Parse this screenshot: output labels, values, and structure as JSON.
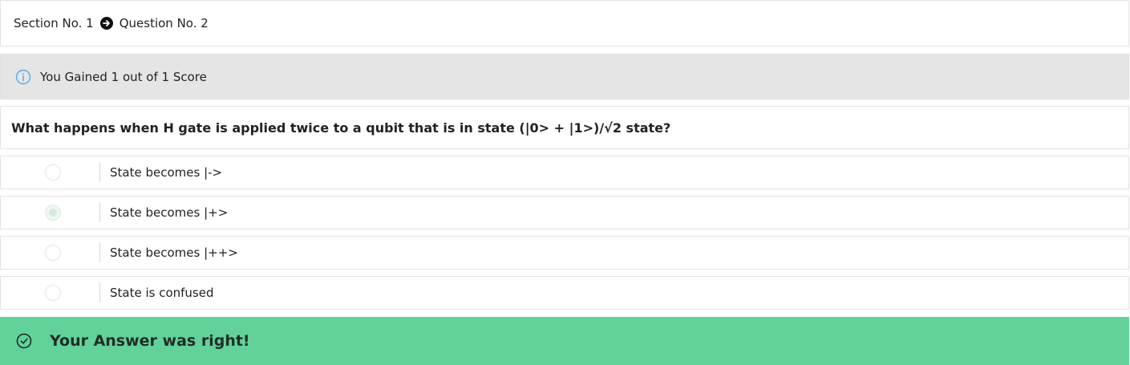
{
  "breadcrumb": {
    "section": "Section No. 1",
    "question": "Question No. 2"
  },
  "score_notice": {
    "text": "You Gained 1 out of 1 Score",
    "icon": "info-circle-icon"
  },
  "question": {
    "text": "What happens when H gate is applied twice to a qubit that is in state (|0> + |1>)/√2 state?"
  },
  "options": [
    {
      "label": "State becomes |->",
      "selected": false
    },
    {
      "label": "State becomes |+>",
      "selected": true
    },
    {
      "label": "State becomes |++>",
      "selected": false
    },
    {
      "label": "State is confused",
      "selected": false
    }
  ],
  "result": {
    "text": "Your Answer was right!",
    "icon": "check-circle-icon"
  },
  "colors": {
    "success": "#62d29a",
    "notice_bg": "#e5e5e5",
    "info_icon": "#5aa9e6"
  }
}
